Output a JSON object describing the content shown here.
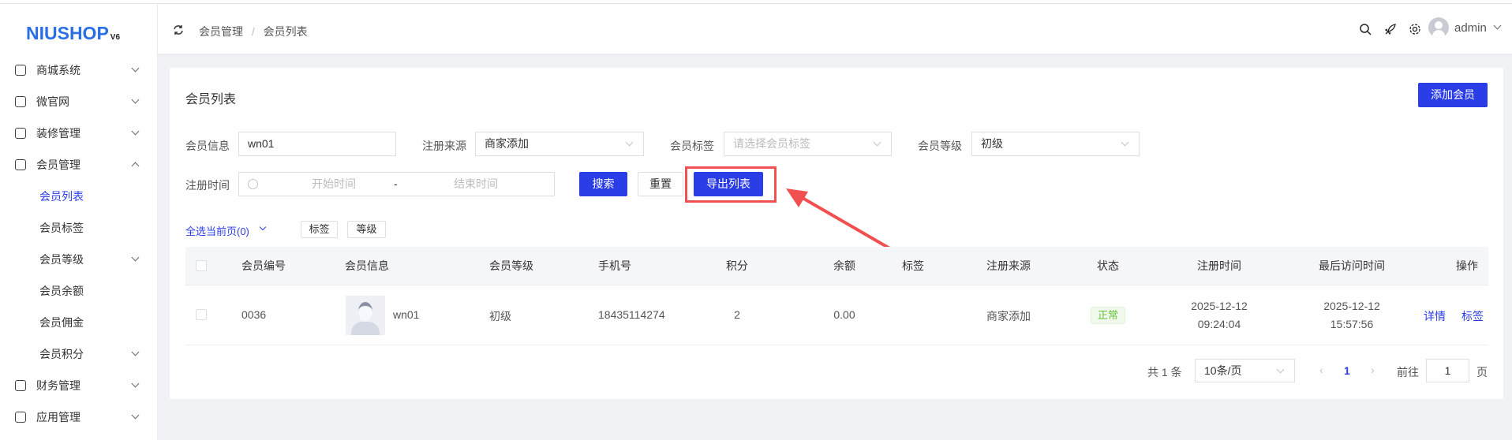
{
  "logo": {
    "text": "NIUSHOP",
    "version": "V6"
  },
  "breadcrumb": [
    "会员管理",
    "会员列表"
  ],
  "breadcrumb_sep": "/",
  "user": {
    "name": "admin"
  },
  "sidebar": {
    "items": [
      {
        "label": "商城系统",
        "icon": "shopping-bag-icon",
        "expanded": false
      },
      {
        "label": "微官网",
        "icon": "globe-icon",
        "expanded": false
      },
      {
        "label": "装修管理",
        "icon": "decoration-icon",
        "expanded": false
      },
      {
        "label": "会员管理",
        "icon": "member-icon",
        "expanded": true
      },
      {
        "label": "会员列表",
        "sub": true,
        "active": true
      },
      {
        "label": "会员标签",
        "sub": true
      },
      {
        "label": "会员等级",
        "sub": true,
        "has_children": true
      },
      {
        "label": "会员余额",
        "sub": true
      },
      {
        "label": "会员佣金",
        "sub": true
      },
      {
        "label": "会员积分",
        "sub": true,
        "has_children": true
      },
      {
        "label": "财务管理",
        "icon": "finance-icon",
        "expanded": false
      },
      {
        "label": "应用管理",
        "icon": "app-icon",
        "expanded": false
      }
    ]
  },
  "page": {
    "title": "会员列表",
    "add_button": "添加会员"
  },
  "filters": {
    "member_info_label": "会员信息",
    "member_info_value": "wn01",
    "source_label": "注册来源",
    "source_value": "商家添加",
    "tag_label": "会员标签",
    "tag_placeholder": "请选择会员标签",
    "level_label": "会员等级",
    "level_value": "初级",
    "time_label": "注册时间",
    "start_placeholder": "开始时间",
    "range_sep": "-",
    "end_placeholder": "结束时间",
    "search": "搜索",
    "reset": "重置",
    "export": "导出列表"
  },
  "batch": {
    "select_page": "全选当前页(0)",
    "tag": "标签",
    "level": "等级"
  },
  "table": {
    "headers": [
      "会员编号",
      "会员信息",
      "会员等级",
      "手机号",
      "积分",
      "余额",
      "标签",
      "注册来源",
      "状态",
      "注册时间",
      "最后访问时间",
      "操作"
    ],
    "rows": [
      {
        "id": "0036",
        "name": "wn01",
        "level": "初级",
        "phone": "18435114274",
        "points": "2",
        "balance": "0.00",
        "tags": "",
        "source": "商家添加",
        "status": "正常",
        "reg_date": "2025-12-12",
        "reg_time": "09:24:04",
        "last_date": "2025-12-12",
        "last_time": "15:57:56",
        "actions": [
          "详情",
          "标签"
        ]
      }
    ]
  },
  "pagination": {
    "total": "共 1 条",
    "page_size": "10条/页",
    "current": "1",
    "goto_label": "前往",
    "goto_value": "1",
    "page_suffix": "页"
  },
  "colors": {
    "primary": "#2a3de6",
    "highlight": "#f05050",
    "success": "#67c23a"
  }
}
